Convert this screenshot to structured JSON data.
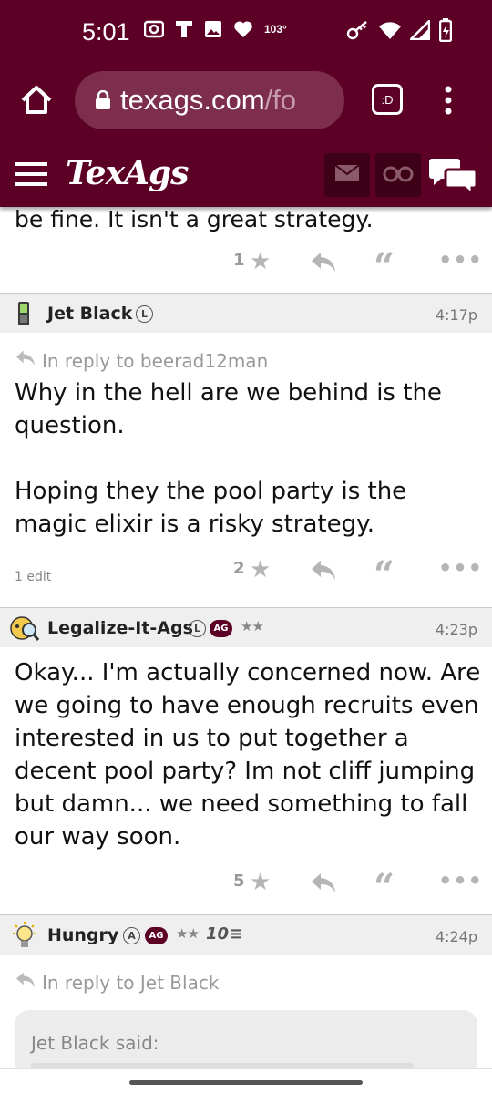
{
  "status_bar": {
    "time": "5:01",
    "temperature": "103°",
    "icons": [
      "radio-icon",
      "t-icon",
      "image-icon",
      "heart-icon",
      "key-icon",
      "wifi-icon",
      "signal-icon",
      "battery-icon"
    ]
  },
  "browser": {
    "url_domain": "texags.com",
    "url_path": "/fo",
    "tab_label": ":D"
  },
  "site": {
    "logo": "TexAgs"
  },
  "colors": {
    "brand_maroon": "#5d0025",
    "header_box": "#3e0016",
    "muted_gray": "#999999"
  },
  "posts": [
    {
      "partial_text": "be fine. It isn't a great strategy.",
      "likes": "1"
    },
    {
      "username": "Jet Black",
      "badges": [
        "L"
      ],
      "time": "4:17p",
      "in_reply_to": "In reply to beerad12man",
      "paragraphs": [
        "Why in the hell are we behind is the question.",
        "Hoping they the pool party is the magic elixir is a risky strategy."
      ],
      "edit_note": "1 edit",
      "likes": "2"
    },
    {
      "username": "Legalize-It-Ags",
      "badges": [
        "L",
        "AG"
      ],
      "stars": "★★",
      "time": "4:23p",
      "paragraphs": [
        "Okay... I'm actually concerned now. Are we going to have enough recruits even interested in us to put together a decent pool party? Im not cliff jumping but damn... we need something to fall our way soon."
      ],
      "likes": "5"
    },
    {
      "username": "Hungry",
      "badges": [
        "A",
        "AG"
      ],
      "stars": "★★",
      "tier_badge": "10",
      "time": "4:24p",
      "in_reply_to": "In reply to Jet Black",
      "quote_author": "Jet Black said:"
    }
  ]
}
